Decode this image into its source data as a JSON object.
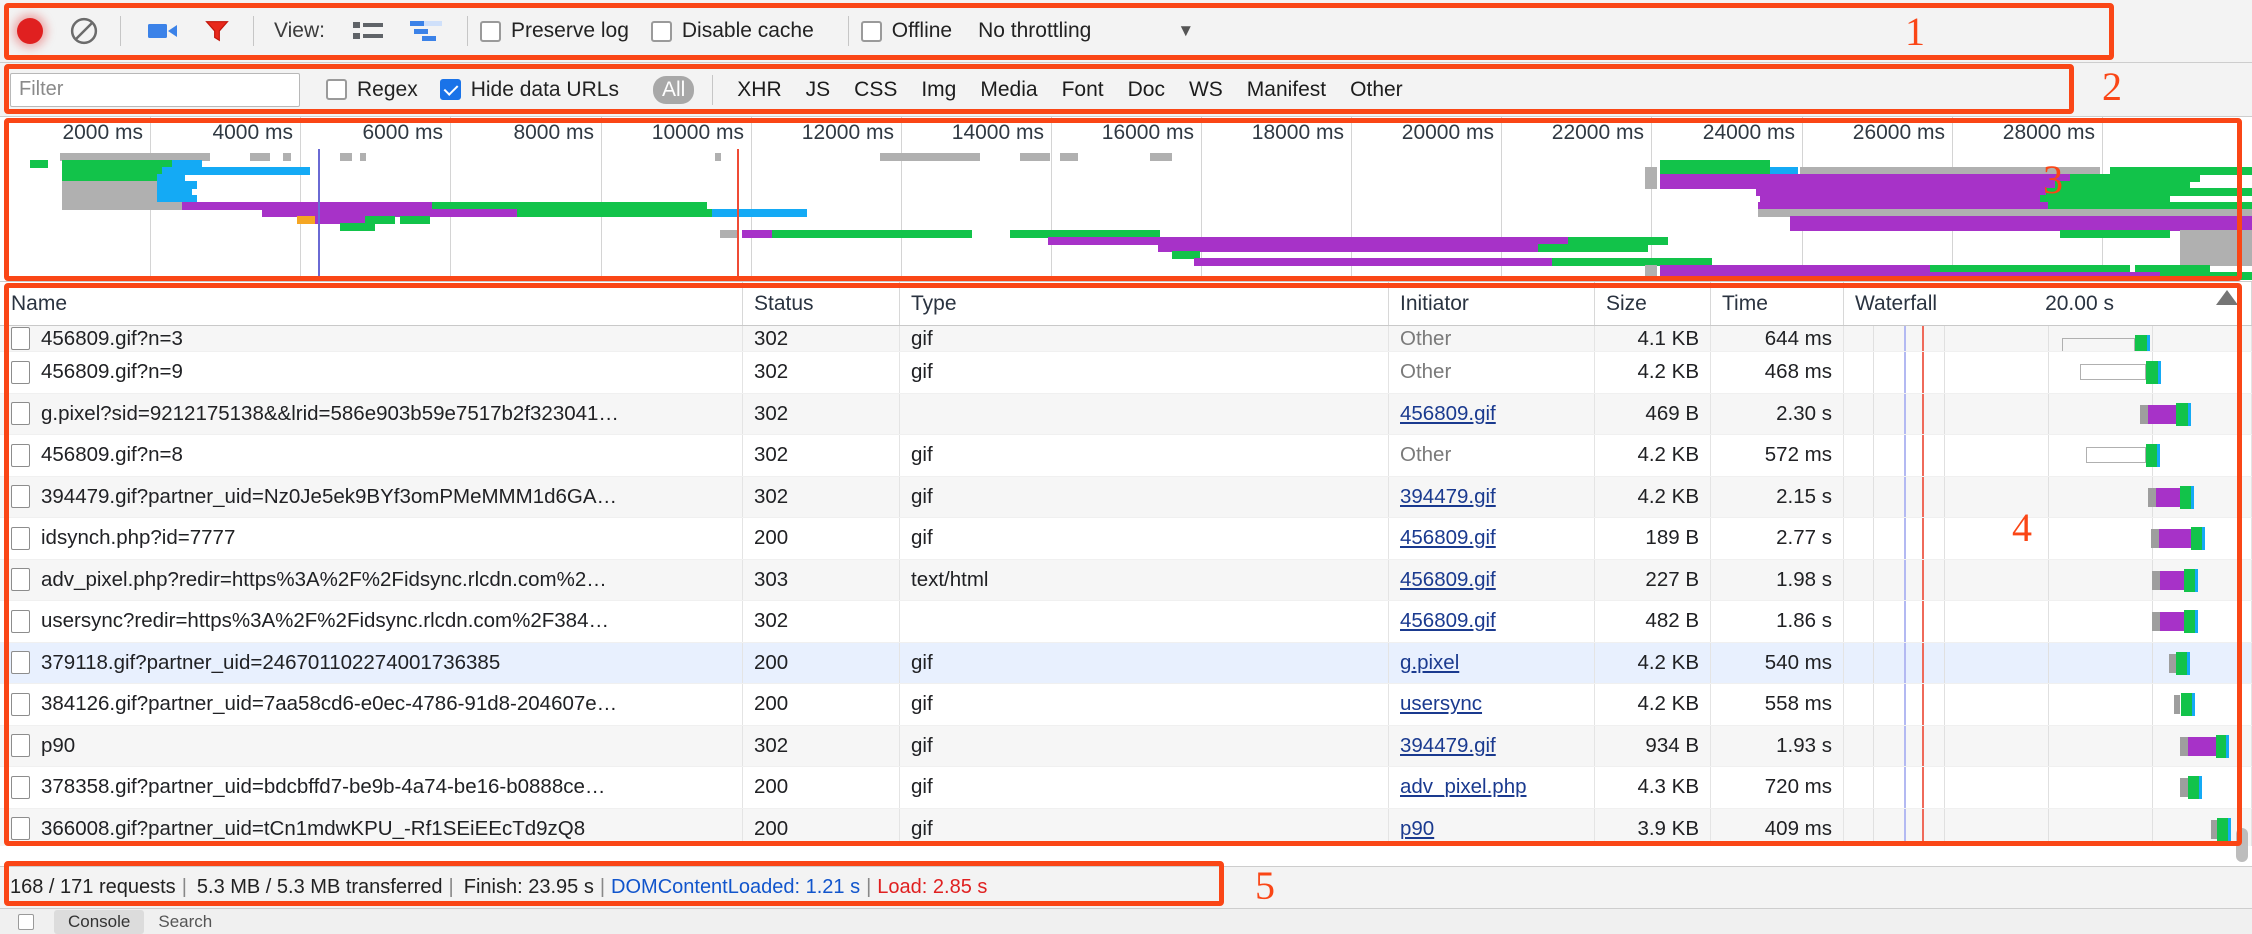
{
  "toolbar": {
    "record_icon": "record-dot-icon",
    "clear_icon": "clear-circle-slash-icon",
    "screenshot_icon": "camera-icon",
    "filter_icon": "funnel-icon",
    "view_label": "View:",
    "view_list_icon": "list-view-icon",
    "view_waterfall_icon": "waterfall-view-icon",
    "preserve_log": {
      "label": "Preserve log",
      "checked": false
    },
    "disable_cache": {
      "label": "Disable cache",
      "checked": false
    },
    "offline": {
      "label": "Offline",
      "checked": false
    },
    "throttling": {
      "value": "No throttling",
      "arrow": "▼"
    }
  },
  "filterbar": {
    "input_placeholder": "Filter",
    "input_value": "",
    "regex": {
      "label": "Regex",
      "checked": false
    },
    "hide_data_urls": {
      "label": "Hide data URLs",
      "checked": true
    },
    "types": [
      "All",
      "XHR",
      "JS",
      "CSS",
      "Img",
      "Media",
      "Font",
      "Doc",
      "WS",
      "Manifest",
      "Other"
    ],
    "active_type": "All"
  },
  "overview": {
    "ruler_ticks": [
      "2000 ms",
      "4000 ms",
      "6000 ms",
      "8000 ms",
      "10000 ms",
      "12000 ms",
      "14000 ms",
      "16000 ms",
      "18000 ms",
      "20000 ms",
      "22000 ms",
      "24000 ms",
      "26000 ms",
      "28000 ms"
    ],
    "dcl_marker_color": "#6a6ad4",
    "load_marker_color": "#ef4b35"
  },
  "table": {
    "headers": [
      "Name",
      "Status",
      "Type",
      "Initiator",
      "Size",
      "Time",
      "Waterfall"
    ],
    "waterfall_scale": "20.00 s",
    "rows": [
      {
        "name": "456809.gif?n=3",
        "status": "302",
        "type": "gif",
        "initiator": "Other",
        "initiator_link": false,
        "size": "4.1 KB",
        "time": "644 ms",
        "sel": false,
        "clipped": true
      },
      {
        "name": "456809.gif?n=9",
        "status": "302",
        "type": "gif",
        "initiator": "Other",
        "initiator_link": false,
        "size": "4.2 KB",
        "time": "468 ms",
        "sel": false
      },
      {
        "name": "g.pixel?sid=9212175138&&lrid=586e903b59e7517b2f323041…",
        "status": "302",
        "type": "",
        "initiator": "456809.gif",
        "initiator_link": true,
        "size": "469 B",
        "time": "2.30 s",
        "sel": false
      },
      {
        "name": "456809.gif?n=8",
        "status": "302",
        "type": "gif",
        "initiator": "Other",
        "initiator_link": false,
        "size": "4.2 KB",
        "time": "572 ms",
        "sel": false
      },
      {
        "name": "394479.gif?partner_uid=Nz0Je5ek9BYf3omPMeMMM1d6GA…",
        "status": "302",
        "type": "gif",
        "initiator": "394479.gif",
        "initiator_link": true,
        "size": "4.2 KB",
        "time": "2.15 s",
        "sel": false
      },
      {
        "name": "idsynch.php?id=7777",
        "status": "200",
        "type": "gif",
        "initiator": "456809.gif",
        "initiator_link": true,
        "size": "189 B",
        "time": "2.77 s",
        "sel": false
      },
      {
        "name": "adv_pixel.php?redir=https%3A%2F%2Fidsync.rlcdn.com%2…",
        "status": "303",
        "type": "text/html",
        "initiator": "456809.gif",
        "initiator_link": true,
        "size": "227 B",
        "time": "1.98 s",
        "sel": false
      },
      {
        "name": "usersync?redir=https%3A%2F%2Fidsync.rlcdn.com%2F384…",
        "status": "302",
        "type": "",
        "initiator": "456809.gif",
        "initiator_link": true,
        "size": "482 B",
        "time": "1.86 s",
        "sel": false
      },
      {
        "name": "379118.gif?partner_uid=246701102274001736385",
        "status": "200",
        "type": "gif",
        "initiator": "g.pixel",
        "initiator_link": true,
        "size": "4.2 KB",
        "time": "540 ms",
        "sel": true
      },
      {
        "name": "384126.gif?partner_uid=7aa58cd6-e0ec-4786-91d8-204607e…",
        "status": "200",
        "type": "gif",
        "initiator": "usersync",
        "initiator_link": true,
        "size": "4.2 KB",
        "time": "558 ms",
        "sel": false
      },
      {
        "name": "p90",
        "status": "302",
        "type": "gif",
        "initiator": "394479.gif",
        "initiator_link": true,
        "size": "934 B",
        "time": "1.93 s",
        "sel": false
      },
      {
        "name": "378358.gif?partner_uid=bdcbffd7-be9b-4a74-be16-b0888ce…",
        "status": "200",
        "type": "gif",
        "initiator": "adv_pixel.php",
        "initiator_link": true,
        "size": "4.3 KB",
        "time": "720 ms",
        "sel": false
      },
      {
        "name": "366008.gif?partner_uid=tCn1mdwKPU_-Rf1SEiEEcTd9zQ8",
        "status": "200",
        "type": "gif",
        "initiator": "p90",
        "initiator_link": true,
        "size": "3.9 KB",
        "time": "409 ms",
        "sel": false
      }
    ]
  },
  "statusbar": {
    "requests": "168 / 171 requests",
    "sep1": "|",
    "transferred": "5.3 MB / 5.3 MB transferred",
    "sep2": "|",
    "finish": "Finish: 23.95 s",
    "sep3": "|",
    "dom_content_loaded": "DOMContentLoaded: 1.21 s",
    "sep4": "|",
    "load": "Load: 2.85 s"
  },
  "bottom": {
    "tab_console": "Console",
    "tab_search": "Search"
  },
  "annotations": [
    {
      "label": "1"
    },
    {
      "label": "2"
    },
    {
      "label": "3"
    },
    {
      "label": "4"
    },
    {
      "label": "5"
    }
  ],
  "colors": {
    "accent_annotation": "#fa4616",
    "record": "#e02020",
    "checkbox_on": "#1a73e8",
    "waterfall_download": "#12c34a",
    "waterfall_request": "#a732c8",
    "waterfall_stalled": "#9e9e9e",
    "link": "#1a3a8f"
  }
}
